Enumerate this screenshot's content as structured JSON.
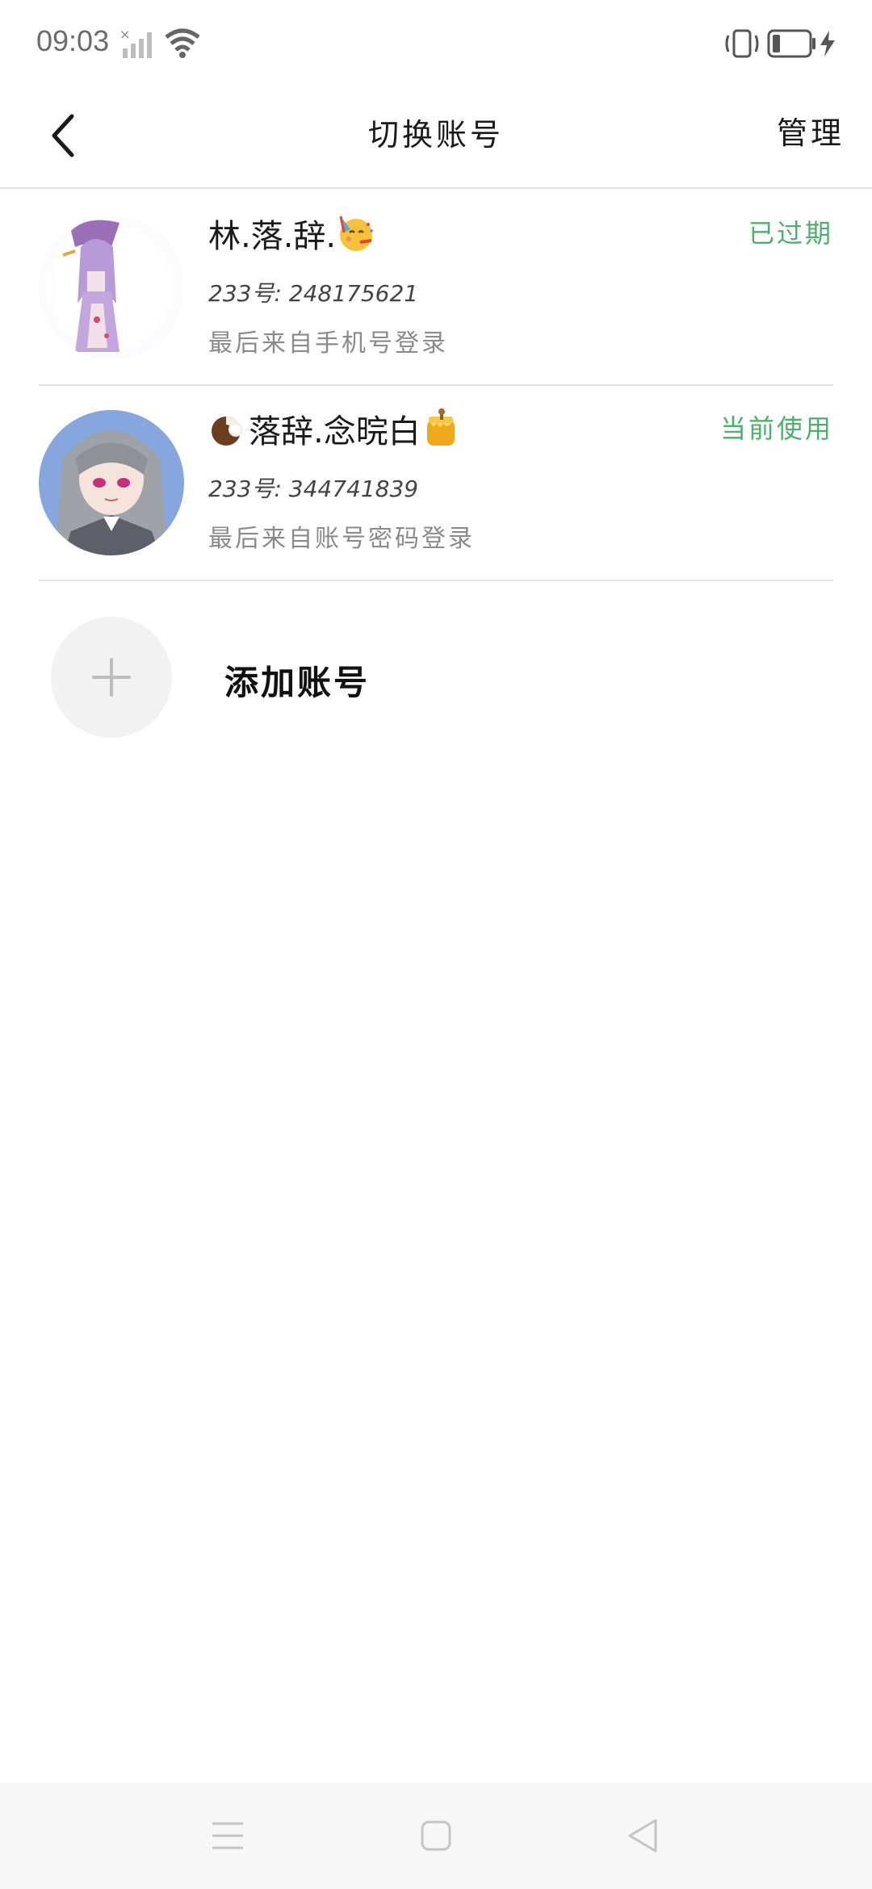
{
  "status_bar": {
    "time": "09:03",
    "icons": [
      "signal-icon",
      "wifi-icon",
      "vibrate-icon",
      "battery-icon",
      "charging-icon"
    ]
  },
  "header": {
    "title": "切换账号",
    "manage_label": "管理",
    "back_icon": "chevron-left-icon"
  },
  "accounts": [
    {
      "name": "林.落.辞.",
      "name_emoji_after": "partying-face",
      "id_text": "233号: 248175621",
      "login_text": "最后来自手机号登录",
      "status": "已过期",
      "status_color": "#4caf6a"
    },
    {
      "name": "落辞.念晥白",
      "name_emoji_before": "coconut",
      "name_emoji_after": "honey-pot",
      "id_text": "233号: 344741839",
      "login_text": "最后来自账号密码登录",
      "status": "当前使用",
      "status_color": "#4caf6a"
    }
  ],
  "add_account": {
    "label": "添加账号",
    "icon": "plus-icon"
  },
  "nav_bar": {
    "icons": [
      "menu-icon",
      "home-icon",
      "back-triangle-icon"
    ]
  },
  "colors": {
    "accent_green": "#4caf6a",
    "divider": "#e3e3e3",
    "secondary_text": "#8a8a8a"
  }
}
